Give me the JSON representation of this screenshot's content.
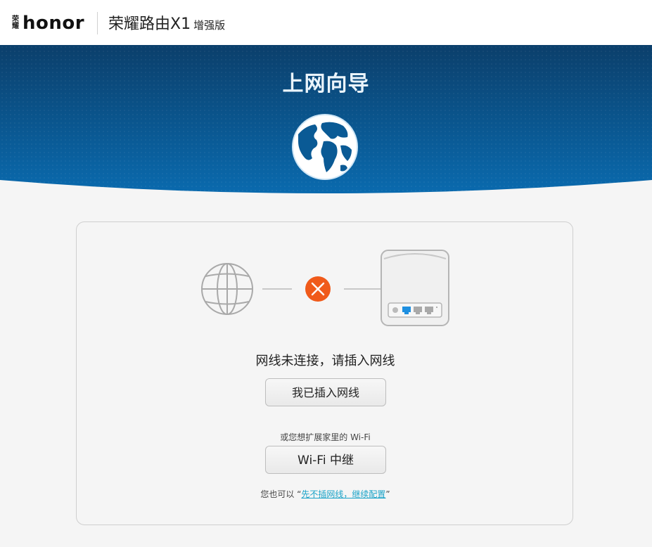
{
  "header": {
    "brand_cn": "荣耀",
    "brand_name": "honor",
    "product_name": "荣耀路由X1",
    "product_edition": "增强版"
  },
  "hero": {
    "title": "上网向导",
    "icon": "globe-icon"
  },
  "card": {
    "diagram": {
      "internet_icon": "globe-outline-icon",
      "status_icon": "error-x-icon",
      "device_icon": "router-icon",
      "status_color": "#f05a1a",
      "port_active_color": "#1e8fe0"
    },
    "status_text": "网线未连接，请插入网线",
    "plugged_button": "我已插入网线",
    "extend_hint": "或您想扩展家里的 Wi-Fi",
    "wifi_relay_button": "Wi-Fi 中继",
    "later_prefix": "您也可以 “",
    "later_link": "先不插网线，继续配置",
    "later_suffix": "”"
  },
  "colors": {
    "hero_dark": "#0b3f6b",
    "hero_light": "#0a66a8",
    "link": "#1aa3c8"
  }
}
